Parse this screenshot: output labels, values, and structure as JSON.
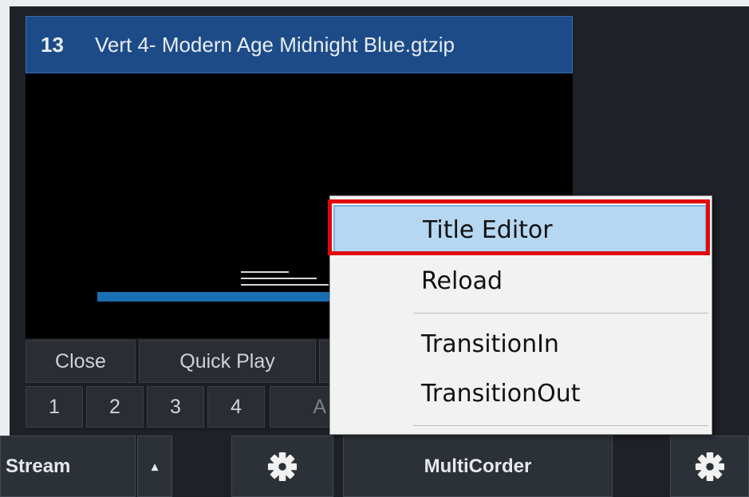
{
  "input": {
    "number": "13",
    "name": "Vert 4- Modern Age Midnight Blue.gtzip"
  },
  "controls": {
    "close": "Close",
    "quick_play": "Quick Play",
    "overlays": [
      "1",
      "2",
      "3",
      "4"
    ],
    "partial_label": "A"
  },
  "bottom_bar": {
    "stream": "Stream",
    "stream_arrow": "▴",
    "multicorder": "MultiCorder"
  },
  "context_menu": {
    "items": [
      "Title Editor",
      "Reload",
      "TransitionIn",
      "TransitionOut"
    ]
  },
  "colors": {
    "title_bar": "#1d4b87",
    "menu_highlight": "#b6d7f2",
    "annotation_box": "#e00a0a"
  },
  "icons": [
    "gear-icon"
  ]
}
